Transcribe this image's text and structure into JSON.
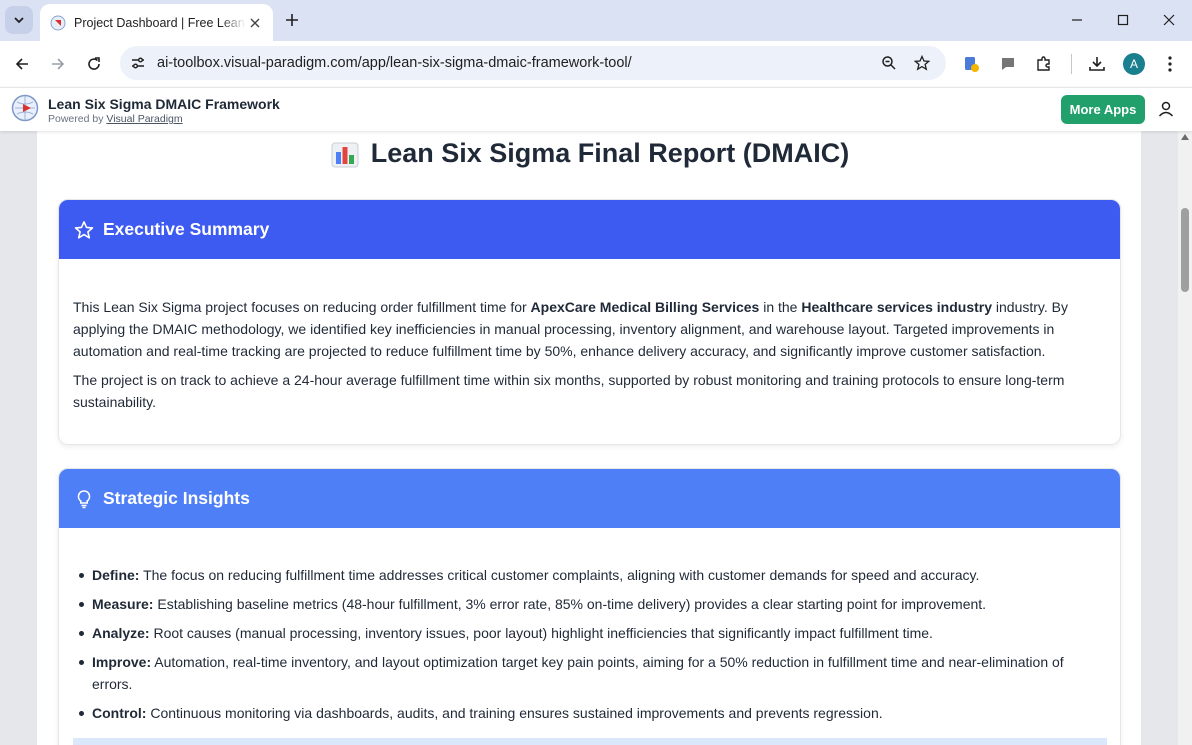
{
  "browser": {
    "tab_title": "Project Dashboard | Free Lean Six Sigma",
    "url": "ai-toolbox.visual-paradigm.com/app/lean-six-sigma-dmaic-framework-tool/",
    "profile_initial": "A"
  },
  "app": {
    "title": "Lean Six Sigma DMAIC Framework",
    "powered_prefix": "Powered by ",
    "powered_link": "Visual Paradigm",
    "more_apps_label": "More Apps"
  },
  "report": {
    "title": "Lean Six Sigma Final Report (DMAIC)",
    "executive_summary": {
      "heading": "Executive Summary",
      "p1_a": "This Lean Six Sigma project focuses on reducing order fulfillment time for ",
      "p1_company": "ApexCare Medical Billing Services",
      "p1_b": " in the ",
      "p1_industry": "Healthcare services industry",
      "p1_c": " industry. By applying the DMAIC methodology, we identified key inefficiencies in manual processing, inventory alignment, and warehouse layout. Targeted improvements in automation and real-time tracking are projected to reduce fulfillment time by 50%, enhance delivery accuracy, and significantly improve customer satisfaction.",
      "p2": "The project is on track to achieve a 24-hour average fulfillment time within six months, supported by robust monitoring and training protocols to ensure long-term sustainability."
    },
    "strategic_insights": {
      "heading": "Strategic Insights",
      "items": [
        {
          "label": "Define:",
          "text": " The focus on reducing fulfillment time addresses critical customer complaints, aligning with customer demands for speed and accuracy."
        },
        {
          "label": "Measure:",
          "text": " Establishing baseline metrics (48-hour fulfillment, 3% error rate, 85% on-time delivery) provides a clear starting point for improvement."
        },
        {
          "label": "Analyze:",
          "text": " Root causes (manual processing, inventory issues, poor layout) highlight inefficiencies that significantly impact fulfillment time."
        },
        {
          "label": "Improve:",
          "text": " Automation, real-time inventory, and layout optimization target key pain points, aiming for a 50% reduction in fulfillment time and near-elimination of errors."
        },
        {
          "label": "Control:",
          "text": " Continuous monitoring via dashboards, audits, and training ensures sustained improvements and prevents regression."
        }
      ]
    }
  },
  "colors": {
    "executive_header": "#3d5af1",
    "insights_header": "#4f7ff6",
    "more_apps": "#22a06b"
  },
  "icons": {
    "report_title": "bar-chart-icon",
    "executive_summary": "star-icon",
    "strategic_insights": "lightbulb-icon"
  }
}
